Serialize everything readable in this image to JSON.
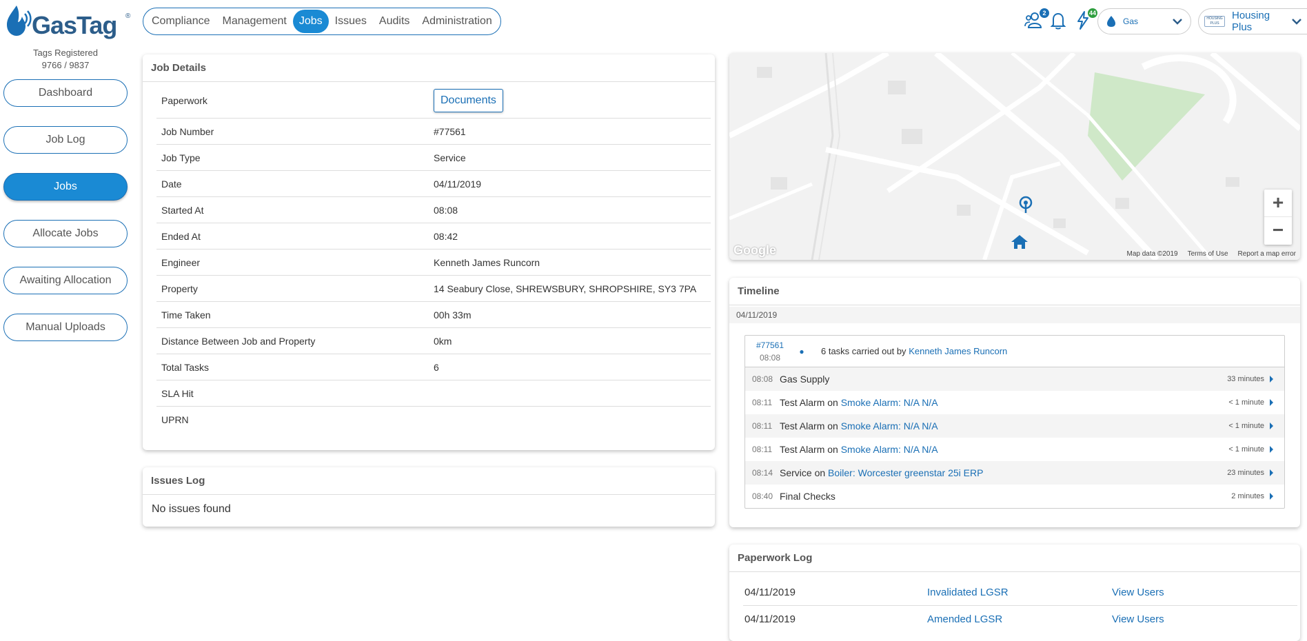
{
  "brand": {
    "name": "GasTag",
    "reg": "®"
  },
  "tags": {
    "label": "Tags Registered",
    "count": "9766 / 9837"
  },
  "sidebar": {
    "items": [
      {
        "label": "Dashboard"
      },
      {
        "label": "Job Log"
      },
      {
        "label": "Jobs"
      },
      {
        "label": "Allocate Jobs"
      },
      {
        "label": "Awaiting Allocation"
      },
      {
        "label": "Manual Uploads"
      }
    ]
  },
  "nav": {
    "items": [
      {
        "label": "Compliance"
      },
      {
        "label": "Management"
      },
      {
        "label": "Jobs"
      },
      {
        "label": "Issues"
      },
      {
        "label": "Audits"
      },
      {
        "label": "Administration"
      }
    ]
  },
  "topbar": {
    "users_badge": "2",
    "activity_badge": "44",
    "fuel_select": "Gas",
    "org_select": "Housing Plus",
    "org_logo_text": "HOUSING PLUS GROUP"
  },
  "job_details": {
    "title": "Job Details",
    "paperwork_label": "Paperwork",
    "documents_button": "Documents",
    "rows": [
      {
        "key": "Job Number",
        "value": "#77561"
      },
      {
        "key": "Job Type",
        "value": "Service"
      },
      {
        "key": "Date",
        "value": "04/11/2019"
      },
      {
        "key": "Started At",
        "value": "08:08"
      },
      {
        "key": "Ended At",
        "value": "08:42"
      },
      {
        "key": "Engineer",
        "value": "Kenneth James Runcorn"
      },
      {
        "key": "Property",
        "value": "14 Seabury Close, SHREWSBURY, SHROPSHIRE, SY3 7PA"
      },
      {
        "key": "Time Taken",
        "value": "00h 33m"
      },
      {
        "key": "Distance Between Job and Property",
        "value": "0km"
      },
      {
        "key": "Total Tasks",
        "value": "6"
      },
      {
        "key": "SLA Hit",
        "value": ""
      },
      {
        "key": "UPRN",
        "value": ""
      }
    ]
  },
  "issues_log": {
    "title": "Issues Log",
    "empty_text": "No issues found"
  },
  "map": {
    "attribution": "Map data ©2019",
    "terms": "Terms of Use",
    "report": "Report a map error",
    "google": "Google"
  },
  "timeline": {
    "title": "Timeline",
    "date": "04/11/2019",
    "job_number": "#77561",
    "job_time": "08:08",
    "summary_prefix": "6 tasks carried out by",
    "summary_engineer": "Kenneth James Runcorn",
    "entries": [
      {
        "time": "08:08",
        "action": "Gas Supply",
        "on": "",
        "target": "",
        "duration": "33 minutes"
      },
      {
        "time": "08:11",
        "action": "Test Alarm",
        "on": "on",
        "target": "Smoke Alarm: N/A N/A",
        "duration": "< 1 minute"
      },
      {
        "time": "08:11",
        "action": "Test Alarm",
        "on": "on",
        "target": "Smoke Alarm: N/A N/A",
        "duration": "< 1 minute"
      },
      {
        "time": "08:11",
        "action": "Test Alarm",
        "on": "on",
        "target": "Smoke Alarm: N/A N/A",
        "duration": "< 1 minute"
      },
      {
        "time": "08:14",
        "action": "Service",
        "on": "on",
        "target": "Boiler: Worcester greenstar 25i ERP",
        "duration": "23 minutes"
      },
      {
        "time": "08:40",
        "action": "Final Checks",
        "on": "",
        "target": "",
        "duration": "2 minutes"
      }
    ]
  },
  "paperwork_log": {
    "title": "Paperwork Log",
    "rows": [
      {
        "date": "04/11/2019",
        "doc": "Invalidated LGSR",
        "action": "View Users"
      },
      {
        "date": "04/11/2019",
        "doc": "Amended LGSR",
        "action": "View Users"
      }
    ]
  },
  "colors": {
    "accent": "#1a8ad4",
    "link": "#1a6fb5",
    "brand": "#2c5d8a",
    "badge_green": "#2e9e3e"
  }
}
